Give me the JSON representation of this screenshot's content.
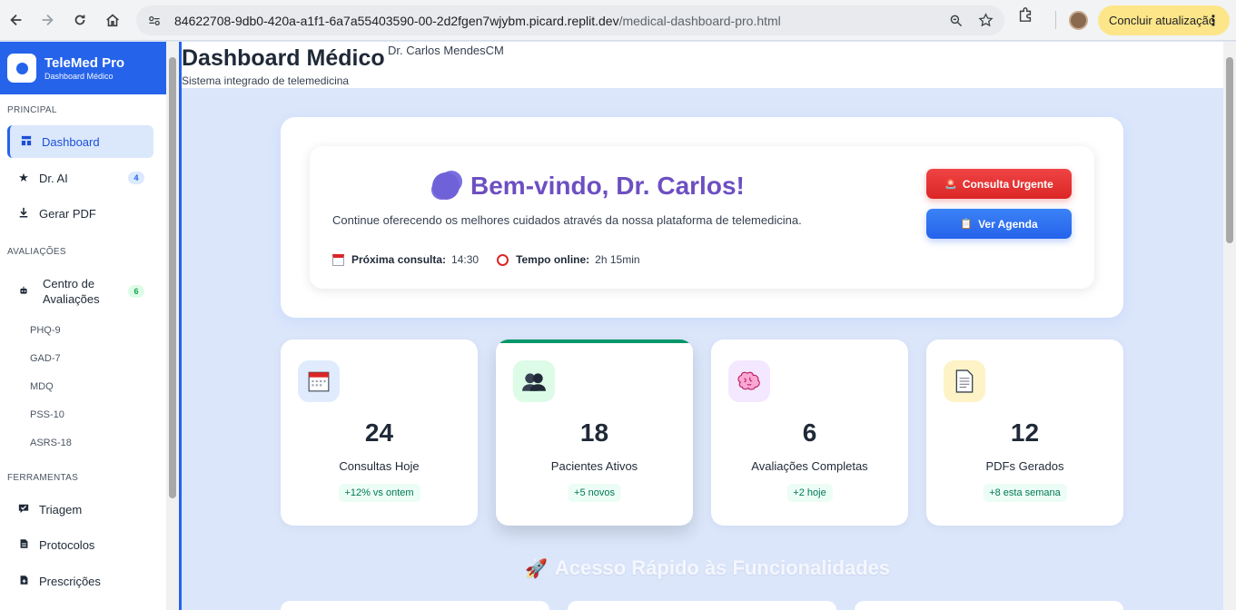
{
  "browser": {
    "url_host": "84622708-9db0-420a-a1f1-6a7a55403590-00-2d2fgen7wjybm.picard.replit.dev",
    "url_path": "/medical-dashboard-pro.html",
    "update_label": "Concluir atualização"
  },
  "sidebar": {
    "brand_title": "TeleMed Pro",
    "brand_subtitle": "Dashboard Médico",
    "sections": {
      "principal": "PRINCIPAL",
      "avaliacoes": "AVALIAÇÕES",
      "ferramentas": "FERRAMENTAS"
    },
    "principal_items": [
      {
        "label": "Dashboard",
        "icon": "dashboard-icon"
      },
      {
        "label": "Dr. AI",
        "icon": "star-icon",
        "badge": "4"
      },
      {
        "label": "Gerar PDF",
        "icon": "download-icon"
      }
    ],
    "avaliacoes_item": {
      "label": "Centro de Avaliações",
      "icon": "robot-icon",
      "badge": "6"
    },
    "avaliacoes_sub": [
      "PHQ-9",
      "GAD-7",
      "MDQ",
      "PSS-10",
      "ASRS-18"
    ],
    "ferramentas_items": [
      {
        "label": "Triagem",
        "icon": "triage-icon"
      },
      {
        "label": "Protocolos",
        "icon": "document-icon"
      },
      {
        "label": "Prescrições",
        "icon": "prescription-icon"
      }
    ]
  },
  "header": {
    "title": "Dashboard Médico",
    "doctor": "Dr. Carlos MendesCM",
    "subtitle": "Sistema integrado de telemedicina"
  },
  "welcome": {
    "title": "Bem-vindo, Dr. Carlos!",
    "description": "Continue oferecendo os melhores cuidados através da nossa plataforma de telemedicina.",
    "next_label": "Próxima consulta:",
    "next_value": "14:30",
    "online_label": "Tempo online:",
    "online_value": "2h 15min",
    "urgent_btn": "Consulta Urgente",
    "agenda_btn": "Ver Agenda"
  },
  "stats": [
    {
      "value": "24",
      "label": "Consultas Hoje",
      "trend": "+12% vs ontem",
      "icon": "calendar-icon",
      "bg": "#e0ecfd"
    },
    {
      "value": "18",
      "label": "Pacientes Ativos",
      "trend": "+5 novos",
      "icon": "users-icon",
      "bg": "#dcfce7"
    },
    {
      "value": "6",
      "label": "Avaliações Completas",
      "trend": "+2 hoje",
      "icon": "brain-icon",
      "bg": "#f3e8ff"
    },
    {
      "value": "12",
      "label": "PDFs Gerados",
      "trend": "+8 esta semana",
      "icon": "page-icon",
      "bg": "#fef3c7"
    }
  ],
  "quick_access_title": "Acesso Rápido às Funcionalidades"
}
